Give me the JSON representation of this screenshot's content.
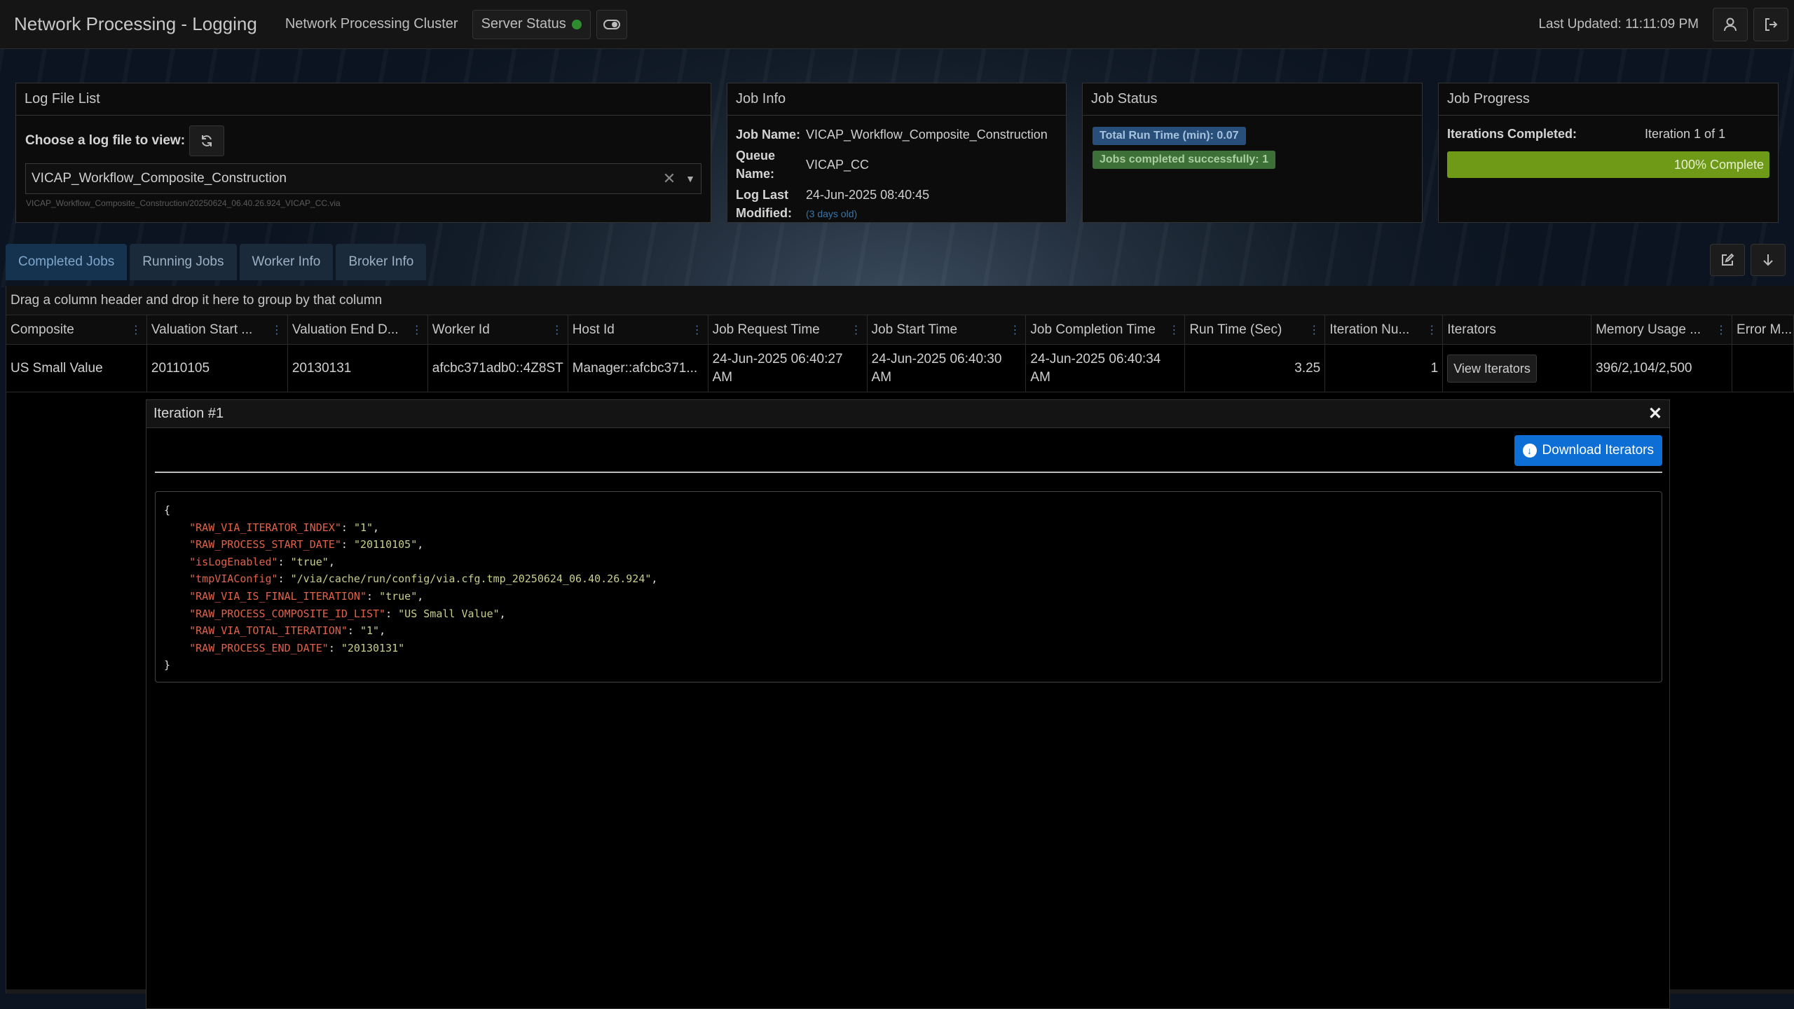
{
  "header": {
    "app_title": "Network Processing - Logging",
    "cluster_name": "Network Processing Cluster",
    "server_status_label": "Server Status",
    "server_status_color": "#2e8b2e",
    "last_updated": "Last Updated: 11:11:09 PM",
    "icons": [
      "toggle-icon",
      "user-icon",
      "logout-icon"
    ]
  },
  "log_file_list": {
    "title": "Log File List",
    "choose_label": "Choose a log file to view:",
    "selected_file": "VICAP_Workflow_Composite_Construction",
    "file_path": "VICAP_Workflow_Composite_Construction/20250624_06.40.26.924_VICAP_CC.via"
  },
  "job_info": {
    "title": "Job Info",
    "job_name_label": "Job Name:",
    "job_name": "VICAP_Workflow_Composite_Construction",
    "queue_label_1": "Queue",
    "queue_label_2": "Name:",
    "queue_name": "VICAP_CC",
    "modified_label_1": "Log Last",
    "modified_label_2": "Modified:",
    "modified": "24-Jun-2025 08:40:45",
    "modified_age": "(3 days old)"
  },
  "job_status": {
    "title": "Job Status",
    "run_time": "Total Run Time (min): 0.07",
    "jobs_completed": "Jobs completed successfully: 1"
  },
  "job_progress": {
    "title": "Job Progress",
    "iterations_label": "Iterations Completed:",
    "iterations_value": "Iteration 1 of 1",
    "percent": 100,
    "percent_label": "100% Complete",
    "bar_color": "#6e9a17"
  },
  "tabs": [
    {
      "label": "Completed Jobs",
      "active": true
    },
    {
      "label": "Running Jobs",
      "active": false
    },
    {
      "label": "Worker Info",
      "active": false
    },
    {
      "label": "Broker Info",
      "active": false
    }
  ],
  "grid": {
    "group_hint": "Drag a column header and drop it here to group by that column",
    "columns": [
      "Composite",
      "Valuation Start ...",
      "Valuation End D...",
      "Worker Id",
      "Host Id",
      "Job Request Time",
      "Job Start Time",
      "Job Completion Time",
      "Run Time (Sec)",
      "Iteration Nu...",
      "Iterators",
      "Memory Usage ...",
      "Error M..."
    ],
    "rows": [
      {
        "composite": "US Small Value",
        "valuation_start": "20110105",
        "valuation_end": "20130131",
        "worker_id": "afcbc371adb0::4Z8ST",
        "host_id": "Manager::afcbc371...",
        "job_request_time": "24-Jun-2025 06:40:27 AM",
        "job_start_time": "24-Jun-2025 06:40:30 AM",
        "job_completion_time": "24-Jun-2025 06:40:34 AM",
        "run_time": "3.25",
        "iteration_number": "1",
        "iterators_button": "View Iterators",
        "memory_usage": "396/2,104/2,500",
        "error_message": ""
      }
    ]
  },
  "dialog": {
    "title": "Iteration #1",
    "download_label": "Download Iterators",
    "json_open": "{",
    "json_close": "}",
    "entries": [
      {
        "key": "\"RAW_VIA_ITERATOR_INDEX\"",
        "value": "\"1\"",
        "comma": ","
      },
      {
        "key": "\"RAW_PROCESS_START_DATE\"",
        "value": "\"20110105\"",
        "comma": ","
      },
      {
        "key": "\"isLogEnabled\"",
        "value": "\"true\"",
        "comma": ","
      },
      {
        "key": "\"tmpVIAConfig\"",
        "value": "\"/via/cache/run/config/via.cfg.tmp_20250624_06.40.26.924\"",
        "comma": ","
      },
      {
        "key": "\"RAW_VIA_IS_FINAL_ITERATION\"",
        "value": "\"true\"",
        "comma": ","
      },
      {
        "key": "\"RAW_PROCESS_COMPOSITE_ID_LIST\"",
        "value": "\"US Small Value\"",
        "comma": ","
      },
      {
        "key": "\"RAW_VIA_TOTAL_ITERATION\"",
        "value": "\"1\"",
        "comma": ","
      },
      {
        "key": "\"RAW_PROCESS_END_DATE\"",
        "value": "\"20130131\"",
        "comma": ""
      }
    ]
  }
}
